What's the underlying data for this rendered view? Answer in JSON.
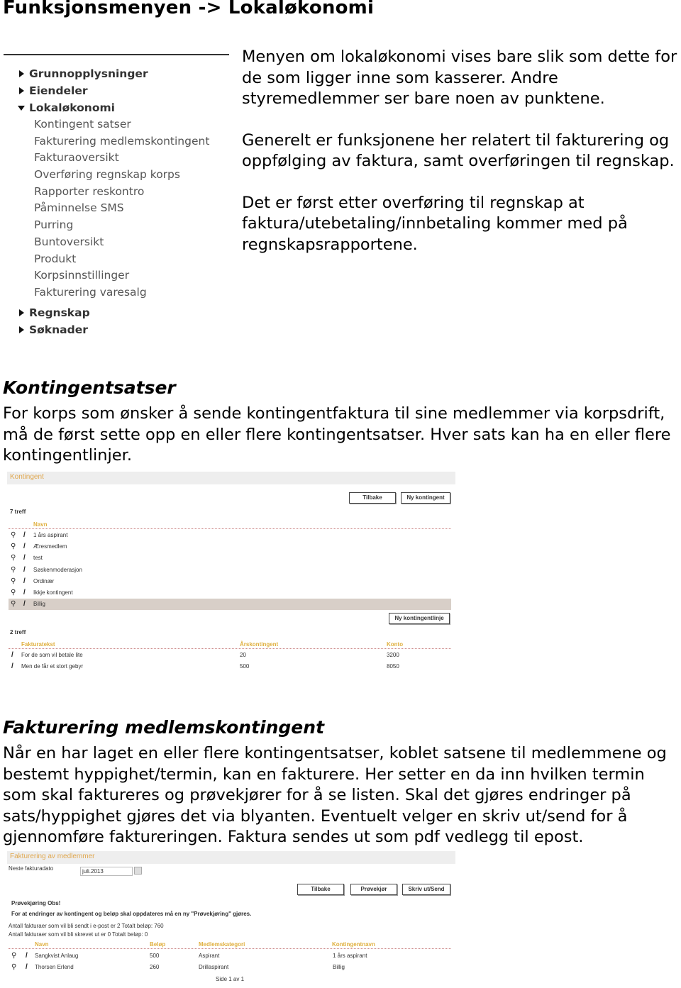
{
  "title": "Funksjonsmenyen -> Lokaløkonomi",
  "menu": {
    "top_items": [
      {
        "label": "Grunnopplysninger"
      },
      {
        "label": "Eiendeler"
      }
    ],
    "open_item": {
      "label": "Lokaløkonomi",
      "children": [
        "Kontingent satser",
        "Fakturering medlemskontingent",
        "Fakturaoversikt",
        "Overføring regnskap korps",
        "Rapporter reskontro",
        "Påminnelse SMS",
        "Purring",
        "Buntoversikt",
        "Produkt",
        "Korpsinnstillinger",
        "Fakturering varesalg"
      ]
    },
    "bottom_items": [
      {
        "label": "Regnskap"
      },
      {
        "label": "Søknader"
      }
    ]
  },
  "intro": [
    "Menyen om lokaløkonomi vises bare slik som dette for de som ligger inne som kasserer. Andre styremedlemmer ser bare noen av punktene.",
    "Generelt er funksjonene her relatert til fakturering og oppfølging av faktura, samt overføringen til regnskap.",
    "Det er først etter overføring til regnskap at faktura/utebetaling/innbetaling kommer med på regnskapsrapportene."
  ],
  "section1": {
    "heading": "Kontingentsatser",
    "text": "For korps som ønsker å sende kontingentfaktura til sine medlemmer via korpsdrift, må de først sette opp en eller flere kontingentsatser. Hver sats kan ha en eller flere kontingentlinjer."
  },
  "kontingent": {
    "header": "Kontingent",
    "back": "Tilbake",
    "new": "Ny kontingent",
    "count": "7 treff",
    "col_name": "Navn",
    "rows": [
      "1 års aspirant",
      "Æresmedlem",
      "test",
      "Søskenmoderasjon",
      "Ordinær",
      "Ikkje kontingent",
      "Billig"
    ],
    "selected": "Billig",
    "new_line": "Ny kontingentlinje",
    "count2": "2 treff",
    "cols2": [
      "Fakturatekst",
      "Årskontingent",
      "Konto"
    ],
    "rows2": [
      [
        "For de som vil betale lite",
        "20",
        "3200"
      ],
      [
        "Men de får et stort gebyr",
        "500",
        "8050"
      ]
    ]
  },
  "section2": {
    "heading": "Fakturering medlemskontingent",
    "text": "Når en har laget en eller flere kontingentsatser, koblet satsene til medlemmene og bestemt hyppighet/termin, kan en fakturere. Her setter en da inn hvilken termin som skal faktureres og prøvekjører for å se listen. Skal det gjøres endringer på sats/hyppighet gjøres det via blyanten. Eventuelt velger en skriv ut/send for å gjennomføre faktureringen. Faktura sendes ut som pdf vedlegg til epost."
  },
  "fakturering": {
    "header": "Fakturering av medlemmer",
    "date_label": "Neste fakturadato",
    "date_value": "juli.2013",
    "back": "Tilbake",
    "test": "Prøvekjør",
    "send": "Skriv ut/Send",
    "warn1": "Prøvekjøring Obs!",
    "warn2": "For at endringer av kontingent og beløp skal oppdateres må en ny \"Prøvekjøring\" gjøres.",
    "info1": "Antall fakturaer som vil bli sendt i e-post er 2 Totalt beløp: 760",
    "info2": "Antall fakturaer som vil bli skrevet ut er 0 Totalt beløp: 0",
    "cols": [
      "Navn",
      "Beløp",
      "Medlemskategori",
      "Kontingentnavn"
    ],
    "rows": [
      [
        "Sangkvist Anlaug",
        "500",
        "Aspirant",
        "1 års aspirant"
      ],
      [
        "Thorsen Erlend",
        "260",
        "Drillaspirant",
        "Billig"
      ]
    ],
    "pager": "Side 1 av 1"
  },
  "colors": {
    "accent": "#e0b040",
    "selected_row": "#d8cfc8"
  }
}
